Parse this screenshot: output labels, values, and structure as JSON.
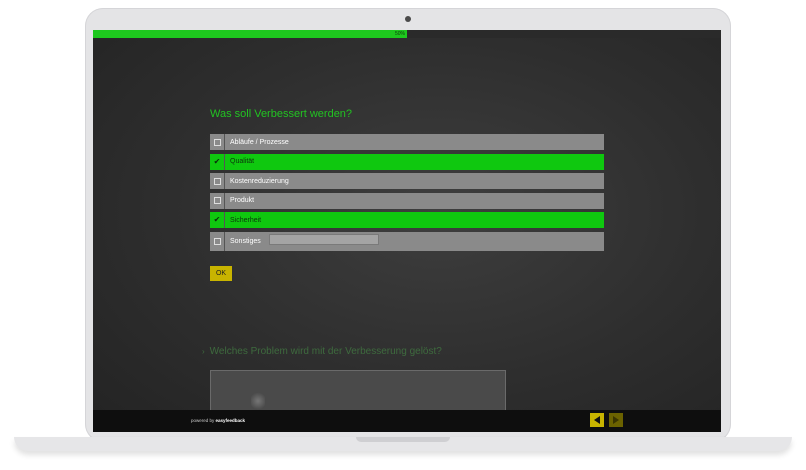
{
  "progress": {
    "value_percent": 50,
    "label": "50%"
  },
  "question1": {
    "title": "Was soll Verbessert werden?",
    "options": [
      {
        "label": "Abläufe / Prozesse",
        "checked": false
      },
      {
        "label": "Qualität",
        "checked": true
      },
      {
        "label": "Kostenreduzierung",
        "checked": false
      },
      {
        "label": "Produkt",
        "checked": false
      },
      {
        "label": "Sicherheit",
        "checked": true
      },
      {
        "label": "Sonstiges",
        "checked": false
      }
    ],
    "other_value": "",
    "ok_label": "OK"
  },
  "question2": {
    "arrow": "›",
    "title": "Welches Problem wird mit der Verbesserung gelöst?"
  },
  "footer": {
    "powered_prefix": "powered by ",
    "brand": "easyfeedback"
  },
  "colors": {
    "accent_green": "#1ec81e",
    "button_yellow": "#c8b400",
    "background": "#2e2e2e"
  },
  "icons": {
    "checked": "check-icon",
    "unchecked": "checkbox-icon",
    "prev": "arrow-left-icon",
    "next": "arrow-right-icon"
  }
}
